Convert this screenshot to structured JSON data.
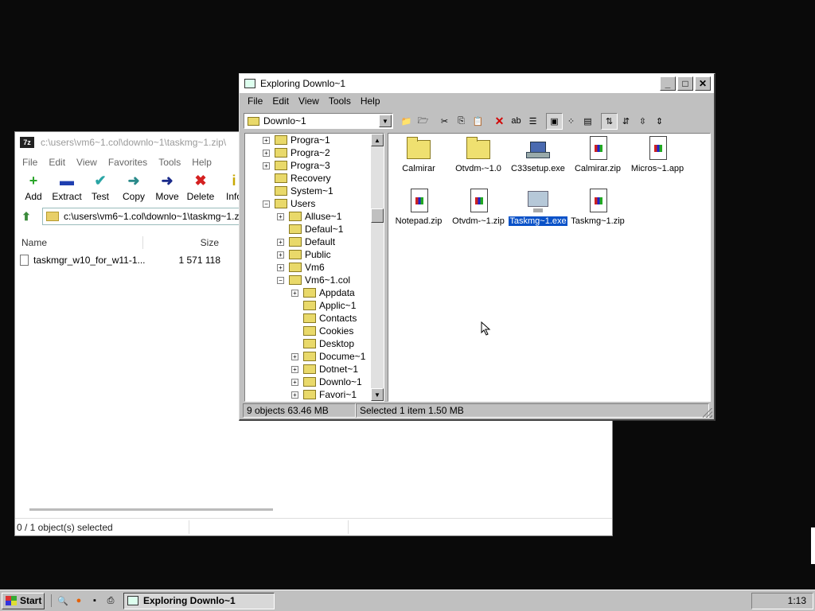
{
  "zip": {
    "title": "c:\\users\\vm6~1.col\\downlo~1\\taskmg~1.zip\\",
    "logo": "7z",
    "menu": [
      "File",
      "Edit",
      "View",
      "Favorites",
      "Tools",
      "Help"
    ],
    "toolbar": [
      {
        "label": "Add",
        "icon": "plus-icon",
        "glyph": "+",
        "color": "#2aa52a"
      },
      {
        "label": "Extract",
        "icon": "minus-icon",
        "glyph": "▬",
        "color": "#1f3fb0"
      },
      {
        "label": "Test",
        "icon": "check-icon",
        "glyph": "✔",
        "color": "#2aa5a5"
      },
      {
        "label": "Copy",
        "icon": "arrow-right-icon",
        "glyph": "➜",
        "color": "#2a8a8a"
      },
      {
        "label": "Move",
        "icon": "arrow-right-icon",
        "glyph": "➜",
        "color": "#1a2a8a"
      },
      {
        "label": "Delete",
        "icon": "x-icon",
        "glyph": "✖",
        "color": "#d42020"
      },
      {
        "label": "Info",
        "icon": "info-icon",
        "glyph": "i",
        "color": "#c8a800"
      }
    ],
    "address": "c:\\users\\vm6~1.col\\downlo~1\\taskmg~1.z",
    "columns": {
      "name": "Name",
      "size": "Size"
    },
    "files": [
      {
        "name": "taskmgr_w10_for_w11-1...",
        "size": "1 571 118"
      }
    ],
    "status": "0 / 1 object(s) selected"
  },
  "explorer": {
    "title": "Exploring Downlo~1",
    "controls": {
      "minimize": "_",
      "maximize": "□",
      "close": "✕"
    },
    "menu": [
      "File",
      "Edit",
      "View",
      "Tools",
      "Help"
    ],
    "combo_value": "Downlo~1",
    "tree": [
      {
        "label": "Progra~1",
        "level": 0,
        "exp": "+"
      },
      {
        "label": "Progra~2",
        "level": 0,
        "exp": "+"
      },
      {
        "label": "Progra~3",
        "level": 0,
        "exp": "+"
      },
      {
        "label": "Recovery",
        "level": 0,
        "exp": ""
      },
      {
        "label": "System~1",
        "level": 0,
        "exp": ""
      },
      {
        "label": "Users",
        "level": 0,
        "exp": "−"
      },
      {
        "label": "Alluse~1",
        "level": 1,
        "exp": "+"
      },
      {
        "label": "Defaul~1",
        "level": 1,
        "exp": ""
      },
      {
        "label": "Default",
        "level": 1,
        "exp": "+"
      },
      {
        "label": "Public",
        "level": 1,
        "exp": "+"
      },
      {
        "label": "Vm6",
        "level": 1,
        "exp": "+"
      },
      {
        "label": "Vm6~1.col",
        "level": 1,
        "exp": "−"
      },
      {
        "label": "Appdata",
        "level": 2,
        "exp": "+"
      },
      {
        "label": "Applic~1",
        "level": 2,
        "exp": ""
      },
      {
        "label": "Contacts",
        "level": 2,
        "exp": ""
      },
      {
        "label": "Cookies",
        "level": 2,
        "exp": ""
      },
      {
        "label": "Desktop",
        "level": 2,
        "exp": ""
      },
      {
        "label": "Docume~1",
        "level": 2,
        "exp": "+"
      },
      {
        "label": "Dotnet~1",
        "level": 2,
        "exp": "+"
      },
      {
        "label": "Downlo~1",
        "level": 2,
        "exp": "+"
      },
      {
        "label": "Favori~1",
        "level": 2,
        "exp": "+"
      }
    ],
    "files": [
      {
        "label": "Calmirar",
        "kind": "folder",
        "selected": false
      },
      {
        "label": "Otvdm-~1.0",
        "kind": "folder",
        "selected": false
      },
      {
        "label": "C33setup.exe",
        "kind": "setup",
        "selected": false
      },
      {
        "label": "Calmirar.zip",
        "kind": "doc",
        "selected": false
      },
      {
        "label": "Micros~1.app",
        "kind": "doc",
        "selected": false
      },
      {
        "label": "Notepad.zip",
        "kind": "doc",
        "selected": false
      },
      {
        "label": "Otvdm-~1.zip",
        "kind": "doc",
        "selected": false
      },
      {
        "label": "Taskmg~1.exe",
        "kind": "monitor",
        "selected": true
      },
      {
        "label": "Taskmg~1.zip",
        "kind": "doc",
        "selected": false
      }
    ],
    "status": {
      "objects": "9 objects  63.46 MB",
      "selected": "Selected 1 item  1.50 MB"
    }
  },
  "taskbar": {
    "start": "Start",
    "task": "Exploring Downlo~1",
    "clock": "1:13"
  }
}
